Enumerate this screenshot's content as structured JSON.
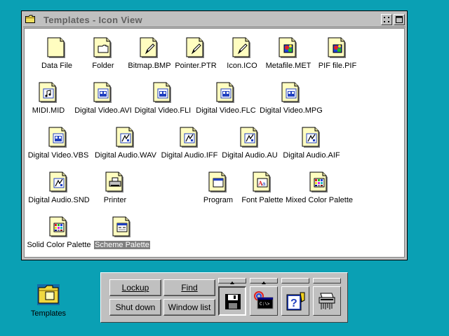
{
  "window": {
    "title": "Templates - Icon View"
  },
  "templates": [
    {
      "label": "Data File",
      "icon": "data-file-icon"
    },
    {
      "label": "Folder",
      "icon": "folder-template-icon"
    },
    {
      "label": "Bitmap.BMP",
      "icon": "bitmap-icon"
    },
    {
      "label": "Pointer.PTR",
      "icon": "pointer-icon"
    },
    {
      "label": "Icon.ICO",
      "icon": "icon-file-icon"
    },
    {
      "label": "Metafile.MET",
      "icon": "metafile-icon"
    },
    {
      "label": "PIF file.PIF",
      "icon": "pif-file-icon"
    },
    {
      "label": "MIDI.MID",
      "icon": "midi-icon"
    },
    {
      "label": "Digital Video.AVI",
      "icon": "video-avi-icon"
    },
    {
      "label": "Digital Video.FLI",
      "icon": "video-fli-icon"
    },
    {
      "label": "Digital Video.FLC",
      "icon": "video-flc-icon"
    },
    {
      "label": "Digital Video.MPG",
      "icon": "video-mpg-icon"
    },
    {
      "label": "Digital Video.VBS",
      "icon": "video-vbs-icon"
    },
    {
      "label": "Digital Audio.WAV",
      "icon": "audio-wav-icon"
    },
    {
      "label": "Digital Audio.IFF",
      "icon": "audio-iff-icon"
    },
    {
      "label": "Digital Audio.AU",
      "icon": "audio-au-icon"
    },
    {
      "label": "Digital Audio.AIF",
      "icon": "audio-aif-icon"
    },
    {
      "label": "Digital Audio.SND",
      "icon": "audio-snd-icon"
    },
    {
      "label": "Printer",
      "icon": "printer-icon"
    },
    {
      "label": "Program",
      "icon": "program-icon"
    },
    {
      "label": "Font Palette",
      "icon": "font-palette-icon"
    },
    {
      "label": "Mixed Color Palette",
      "icon": "mixed-color-palette-icon"
    },
    {
      "label": "Solid Color Palette",
      "icon": "solid-color-palette-icon"
    },
    {
      "label": "Scheme Palette",
      "icon": "scheme-palette-icon",
      "selected": true
    }
  ],
  "desktop": {
    "templates_folder_label": "Templates"
  },
  "launchpad": {
    "lockup": "Lockup",
    "find": "Find",
    "shutdown": "Shut down",
    "windowlist": "Window list",
    "icons": [
      "drives-icon",
      "os2-window-icon",
      "help-icon",
      "shredder-icon"
    ]
  },
  "colors": {
    "desktop": "#0aa0b4",
    "face": "#c0c0c0",
    "selection": "#808080",
    "template_paper": "#fffdc0"
  }
}
